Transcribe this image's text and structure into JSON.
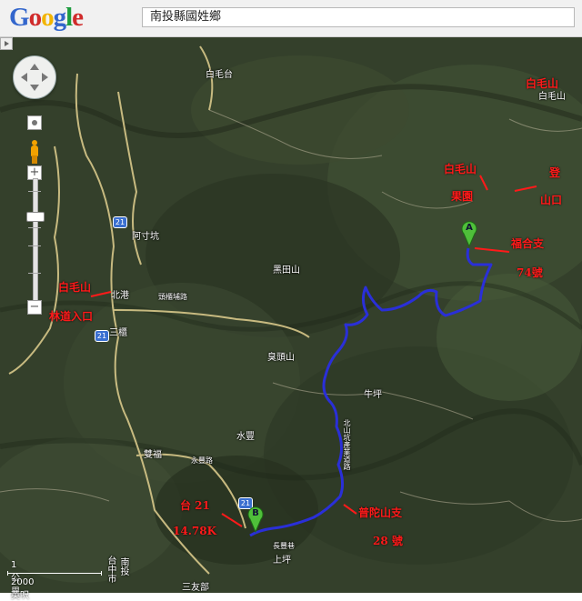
{
  "header": {
    "logo_letters": [
      {
        "ch": "G",
        "color": "#3366cc"
      },
      {
        "ch": "o",
        "color": "#d02b2b"
      },
      {
        "ch": "o",
        "color": "#f2b400"
      },
      {
        "ch": "g",
        "color": "#3366cc"
      },
      {
        "ch": "l",
        "color": "#1c9c3e"
      },
      {
        "ch": "e",
        "color": "#d02b2b"
      }
    ],
    "search_value": "南投縣國姓鄉"
  },
  "controls": {
    "zoom_in": "+",
    "zoom_out": "−"
  },
  "place_labels": {
    "baimaotai": "白毛台",
    "baimaoshan_peak": "白毛山",
    "acunkang": "阿寸坑",
    "heitianshan": "黑田山",
    "beiyuan": "北港",
    "toulunpu": "頭櫃埔路",
    "sanke": "三櫃",
    "choutoushan": "臭頭山",
    "niuping": "牛坪",
    "shuifeng": "水豐",
    "shuangfu": "雙福",
    "yongfeng": "永豐路",
    "changfeng": "長豐巷",
    "shangping": "上坪",
    "sanyoubu": "三友部",
    "taichung": "台中市",
    "nanshi": "南投",
    "road_name": "北山坑產業道路"
  },
  "route_shields": {
    "r1": "21",
    "r2": "21",
    "r3": "21"
  },
  "annotations": {
    "baimaoshan": "白毛山",
    "orchard_a": "白毛山",
    "orchard_b": "果園",
    "trail_a": "登",
    "trail_b": "山口",
    "forest_a": "白毛山",
    "forest_b": "林道入口",
    "branch_a": "福合支",
    "branch_b": "74號",
    "tai_a": "台 21",
    "tai_b": "14.78K",
    "putuo_a": "普陀山支",
    "putuo_b": "28 號"
  },
  "markers": {
    "a": "A",
    "b": "B"
  },
  "scale": {
    "top": "1 公里",
    "bottom": "2000 英呎"
  },
  "colors": {
    "route": "#2a2fd8",
    "marker": "#4fbf3a",
    "annotation": "#ff1a1a",
    "road": "#d8c88a"
  }
}
